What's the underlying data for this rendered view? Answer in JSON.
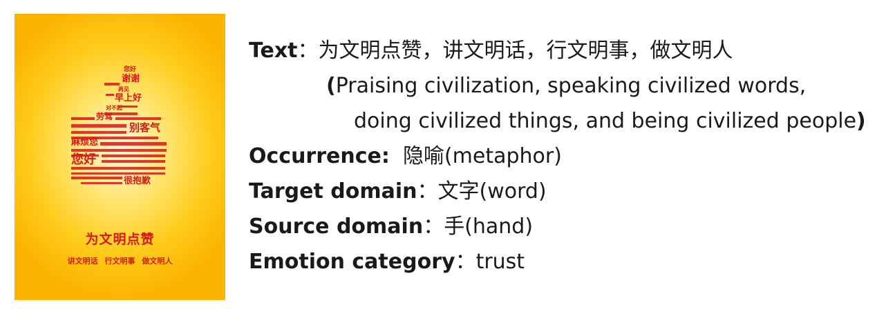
{
  "poster": {
    "cloud_words": [
      "您好",
      "谢谢",
      "再见",
      "早上好",
      "对不起",
      "劳驾",
      "别客气",
      "麻烦您",
      "您好",
      "很抱歉"
    ],
    "title": "为文明点赞",
    "subtitle": "讲文明话  行文明事  做文明人",
    "colors": {
      "accent": "#d81919",
      "background": "#fbb400"
    }
  },
  "annotation": {
    "text_label": "Text",
    "text_sep": "：",
    "text_value": "为文明点赞，讲文明话，行文明事，做文明人",
    "translation_open": "(",
    "translation_line1": "Praising civilization, speaking civilized words,",
    "translation_line2": "doing civilized things, and being civilized people",
    "translation_close": ")",
    "occurrence_label": "Occurrence:",
    "occurrence_value": "隐喻(metaphor)",
    "target_label": "Target domain",
    "target_sep": "：",
    "target_value": "文字(word)",
    "source_label": "Source domain",
    "source_sep": "：",
    "source_value": "手(hand)",
    "emotion_label": "Emotion category",
    "emotion_sep": "：",
    "emotion_value": "trust"
  }
}
